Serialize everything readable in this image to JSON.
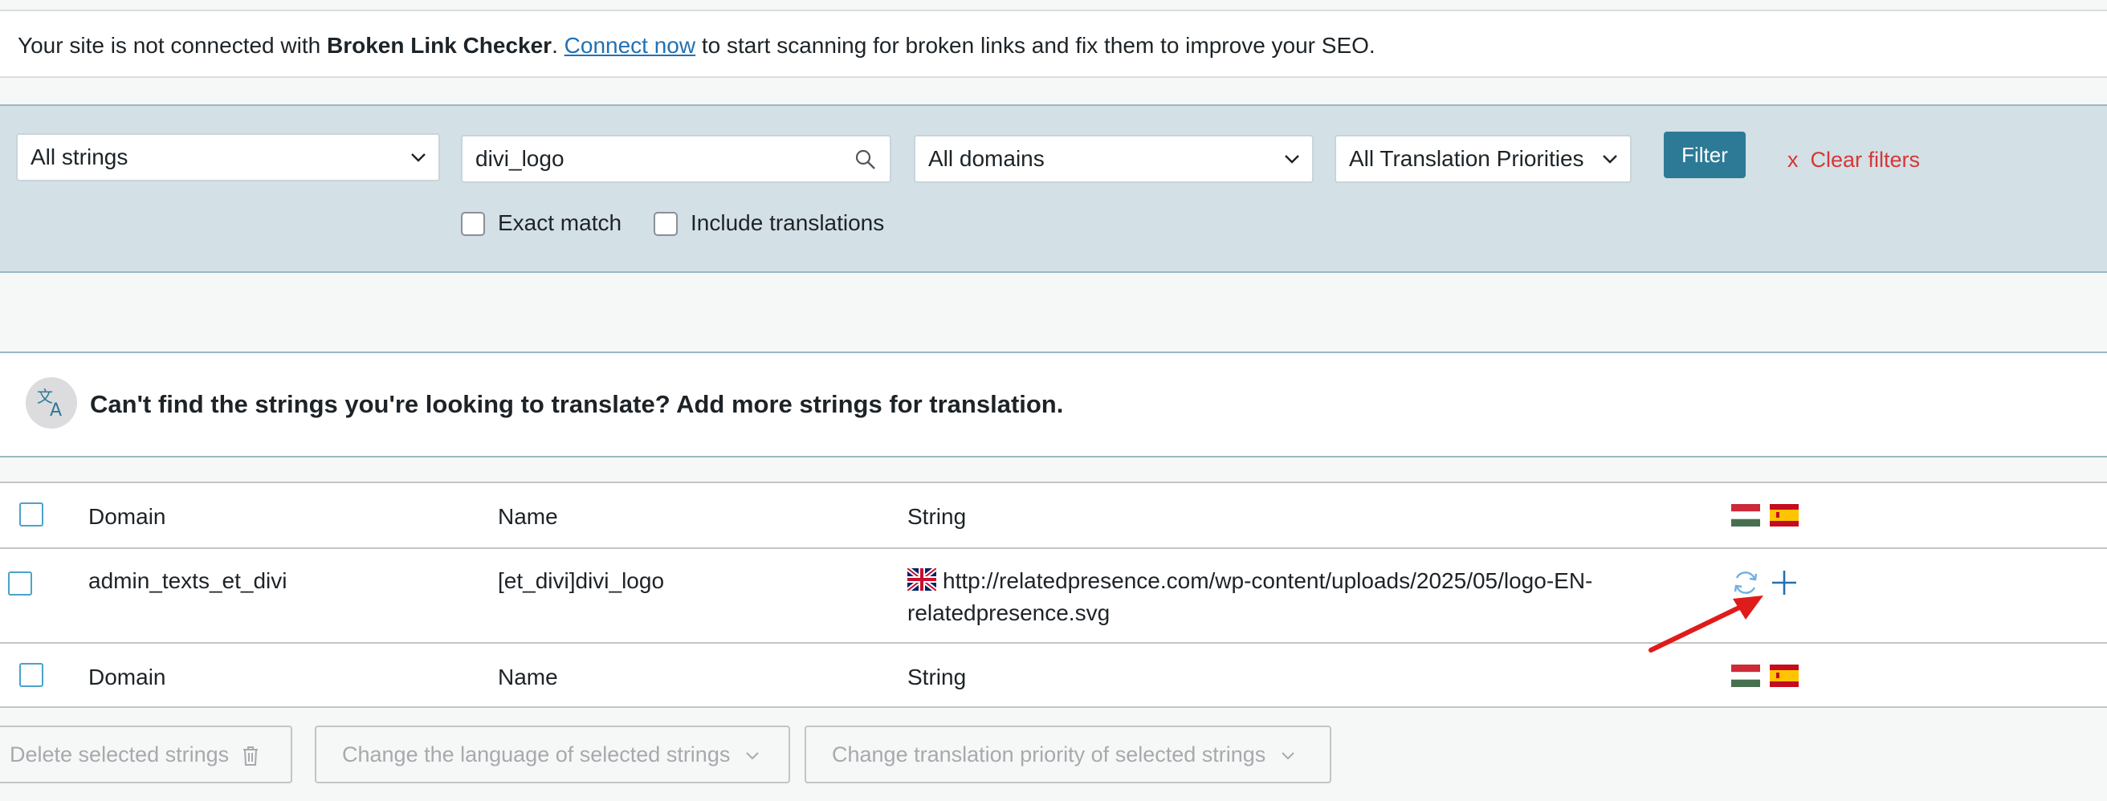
{
  "notice": {
    "text_before": "Your site is not connected with ",
    "brand": "Broken Link Checker",
    "period": ". ",
    "link": "Connect now",
    "text_after": " to start scanning for broken links and fix them to improve your SEO."
  },
  "filters": {
    "strings_select": "All strings",
    "search_value": "divi_logo",
    "domains_select": "All domains",
    "priority_select": "All Translation Priorities",
    "filter_button": "Filter",
    "clear_icon": "x",
    "clear_label": "Clear filters",
    "exact_match": "Exact match",
    "include_translations": "Include translations"
  },
  "add_strings": {
    "icon": "translate-icon",
    "text": "Can't find the strings you're looking to translate? Add more strings for translation."
  },
  "table": {
    "headers": {
      "domain": "Domain",
      "name": "Name",
      "string": "String"
    },
    "header_flags": [
      "hungary-flag",
      "spain-flag"
    ],
    "rows": [
      {
        "domain": "admin_texts_et_divi",
        "name": "[et_divi]divi_logo",
        "string_line1": "http://relatedpresence.com/wp-content/uploads/2025/05/logo-EN-",
        "string_line2": "relatedpresence.svg",
        "source_flag": "uk-flag",
        "actions": [
          "refresh-icon",
          "plus-icon"
        ]
      }
    ],
    "footers": {
      "domain": "Domain",
      "name": "Name",
      "string": "String"
    }
  },
  "bulk_actions": {
    "delete": "Delete selected strings",
    "change_language": "Change the language of selected strings",
    "change_priority": "Change translation priority of selected strings"
  },
  "colors": {
    "accent": "#2c7a96",
    "clear": "#d63638",
    "link": "#2271b1",
    "annotation_arrow": "#e01b1b"
  }
}
